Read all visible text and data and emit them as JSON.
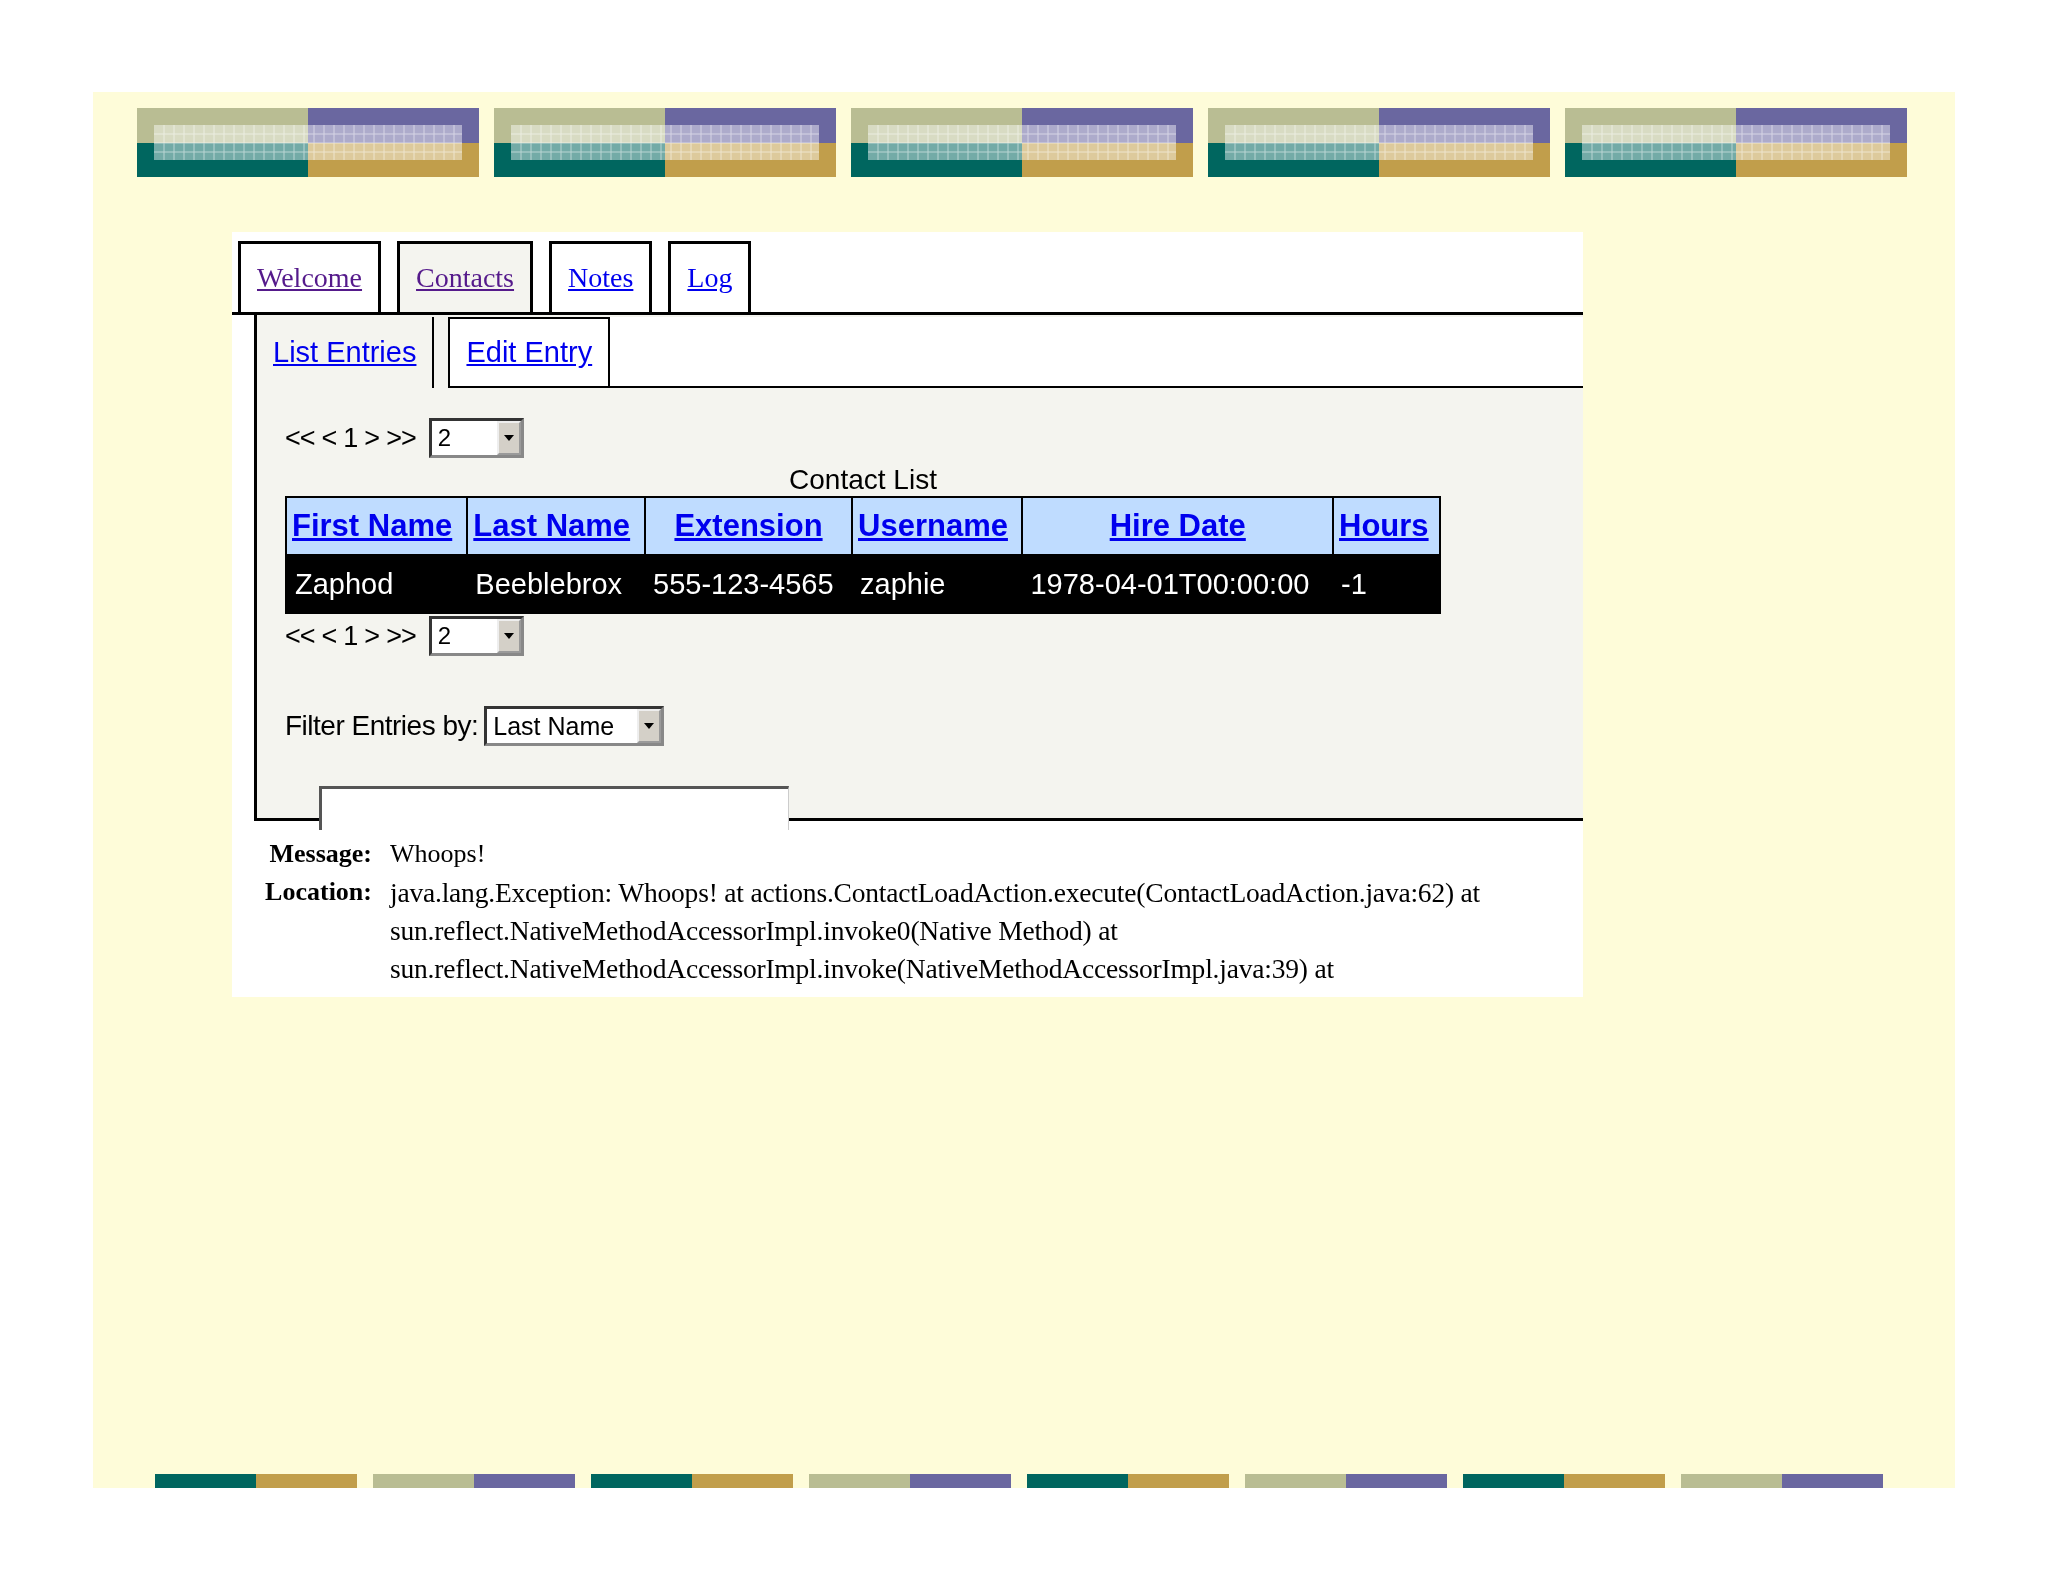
{
  "tabs": [
    {
      "label": "Welcome",
      "selected": false,
      "visited": true
    },
    {
      "label": "Contacts",
      "selected": true,
      "visited": true
    },
    {
      "label": "Notes",
      "selected": false,
      "visited": false
    },
    {
      "label": "Log",
      "selected": false,
      "visited": false
    }
  ],
  "subtabs": [
    {
      "label": "List Entries",
      "selected": true
    },
    {
      "label": "Edit Entry",
      "selected": false
    }
  ],
  "pager_top": {
    "links": [
      "<<",
      "<",
      "1",
      ">",
      ">>"
    ],
    "page_size": "2"
  },
  "table": {
    "caption": "Contact List",
    "columns": [
      "First Name",
      "Last Name",
      "Extension",
      "Username",
      "Hire Date",
      "Hours"
    ],
    "rows": [
      [
        "Zaphod",
        "Beeblebrox",
        "555-123-4565",
        "zaphie",
        "1978-04-01T00:00:00",
        "-1"
      ]
    ]
  },
  "pager_bottom": {
    "links": [
      "<<",
      "<",
      "1",
      ">",
      ">>"
    ],
    "page_size": "2"
  },
  "filter": {
    "label": "Filter Entries by:",
    "value": "Last Name"
  },
  "error": {
    "message_label": "Message:",
    "message": "Whoops!",
    "location_label": "Location:",
    "location_lines": [
      "java.lang.Exception: Whoops! at actions.ContactLoadAction.execute(ContactLoadAction.java:62) at",
      "sun.reflect.NativeMethodAccessorImpl.invoke0(Native Method) at",
      "sun.reflect.NativeMethodAccessorImpl.invoke(NativeMethodAccessorImpl.java:39) at"
    ]
  }
}
